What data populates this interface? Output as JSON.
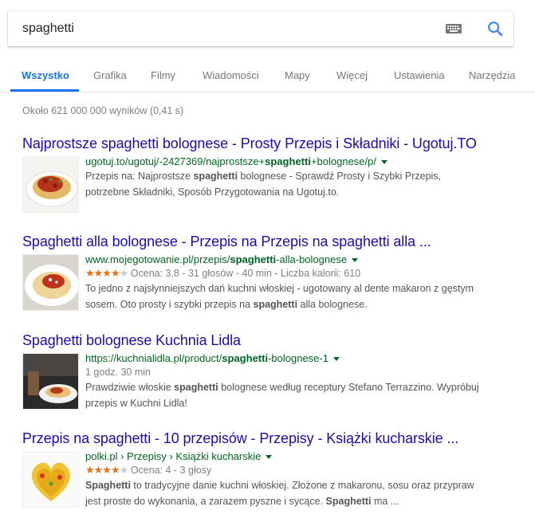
{
  "search": {
    "query": "spaghetti"
  },
  "tabs": [
    {
      "label": "Wszystko",
      "active": true
    },
    {
      "label": "Grafika"
    },
    {
      "label": "Filmy"
    },
    {
      "label": "Wiadomości"
    },
    {
      "label": "Mapy"
    },
    {
      "label": "Więcej"
    },
    {
      "label": "Ustawienia"
    },
    {
      "label": "Narzędzia"
    }
  ],
  "stats": "Około 621 000 000 wyników (0,41 s)",
  "results": [
    {
      "title": "Najprostsze spaghetti bolognese - Prosty Przepis i Składniki - Ugotuj.TO",
      "url_pre": "ugotuj.to/ugotuj/-2427369/najprostsze+",
      "url_bold": "spaghetti",
      "url_post": "+bolognese/p/",
      "snippet_1_pre": "Przepis na: Najprostsze ",
      "snippet_1_bold": "spaghetti",
      "snippet_1_post": " bolognese - Sprawdź Prosty i Szybki Przepis,",
      "snippet_2": "potrzebne Składniki, Sposób Przygotowania na Ugotuj.to."
    },
    {
      "title": "Spaghetti alla bolognese - Przepis na Przepis na spaghetti alla ...",
      "url_pre": "www.mojegotowanie.pl/przepis/",
      "url_bold": "spaghetti",
      "url_post": "-alla-bolognese",
      "rating_stars": 3.8,
      "rating_text": "Ocena: 3,8 - 31 głosów - 40 min - Liczba kalorii: 610",
      "snippet_1": "To jedno z najsłynniejszych dań kuchni włoskiej - ugotowany al dente makaron z gęstym",
      "snippet_2_pre": "sosem. Oto prosty i szybki przepis na ",
      "snippet_2_bold": "spaghetti",
      "snippet_2_post": " alla bolognese."
    },
    {
      "title": "Spaghetti bolognese Kuchnia Lidla",
      "url_pre": "https://kuchnialidla.pl/product/",
      "url_bold": "spaghetti",
      "url_post": "-bolognese-1",
      "time": "1 godz. 30 min",
      "snippet_1_pre": "Prawdziwie włoskie ",
      "snippet_1_bold": "spaghetti",
      "snippet_1_post": " bolognese według receptury Stefano Terrazzino. Wypróbuj",
      "snippet_2": "przepis w Kuchni Lidla!"
    },
    {
      "title": "Przepis na spaghetti - 10 przepisów - Przepisy - Książki kucharskie ...",
      "url_text": "polki.pl › Przepisy › Książki kucharskie",
      "rating_stars": 4,
      "rating_text": "Ocena: 4 - 3 głosy",
      "snippet_1_bold": "Spaghetti",
      "snippet_1_post": " to tradycyjne danie kuchni włoskiej. Złożone z makaronu, sosu oraz przypraw",
      "snippet_2_pre": "jest proste do wykonania, a zarazem pyszne i sycące. ",
      "snippet_2_bold": "Spaghetti",
      "snippet_2_post": " ma ..."
    }
  ],
  "icons": {
    "keyboard": "keyboard-icon",
    "search": "search-icon",
    "caret": "caret-down-icon",
    "star": "star-icon"
  },
  "colors": {
    "title_link": "#1a0dab",
    "url": "#006621",
    "accent": "#1a73e8",
    "star": "#e7711b"
  }
}
